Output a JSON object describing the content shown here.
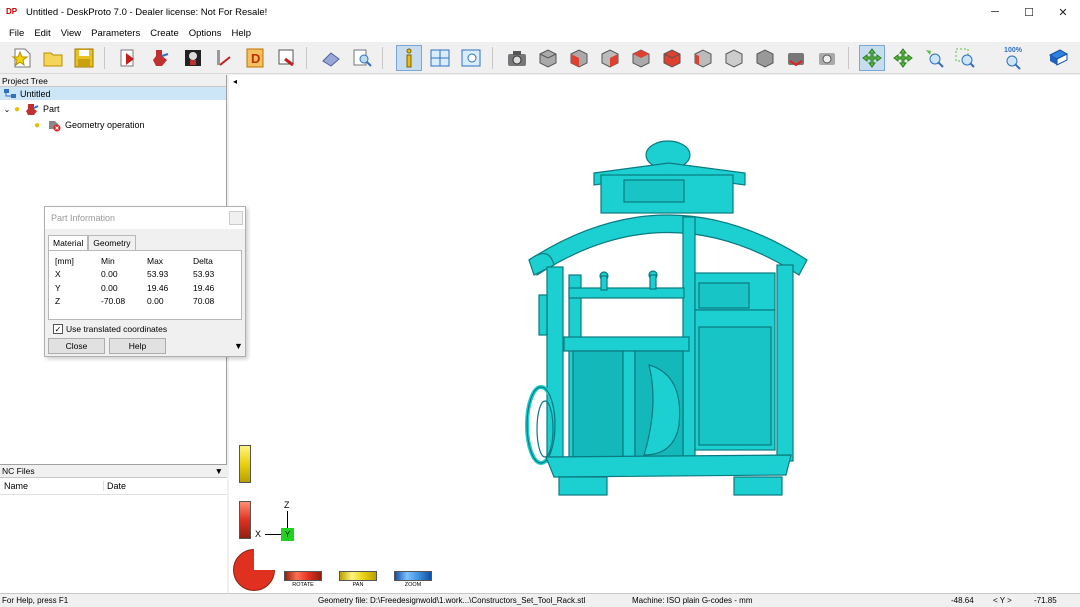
{
  "window": {
    "title": "Untitled - DeskProto 7.0 - Dealer license: Not For Resale!",
    "icon_text": "DP",
    "minimize": "─",
    "maximize": "☐",
    "close": "✕"
  },
  "menu": [
    "File",
    "Edit",
    "View",
    "Parameters",
    "Create",
    "Options",
    "Help"
  ],
  "project_tree": {
    "header": "Project Tree",
    "root": "Untitled",
    "part": "Part",
    "operation": "Geometry operation"
  },
  "nc_files": {
    "header": "NC Files",
    "col_name": "Name",
    "col_date": "Date"
  },
  "part_info": {
    "title": "Part Information",
    "tabs": [
      "Material",
      "Geometry"
    ],
    "columns": [
      "[mm]",
      "Min",
      "Max",
      "Delta"
    ],
    "rows": [
      [
        "X",
        "0.00",
        "53.93",
        "53.93"
      ],
      [
        "Y",
        "0.00",
        "19.46",
        "19.46"
      ],
      [
        "Z",
        "-70.08",
        "0.00",
        "70.08"
      ]
    ],
    "checkbox_label": "Use translated coordinates",
    "checkbox_checked": true,
    "close_label": "Close",
    "help_label": "Help"
  },
  "axes": {
    "z": "Z",
    "x": "X",
    "y": "Y"
  },
  "nav": {
    "rotate": "ROTATE",
    "pan": "PAN",
    "zoom": "ZOOM"
  },
  "toolbar_zoom_label": "100%",
  "status": {
    "help": "For Help, press F1",
    "geometry_file": "Geometry file: D:\\Freedesignwold\\1.work...\\Constructors_Set_Tool_Rack.stl",
    "machine": "Machine: ISO plain G-codes - mm",
    "coord_x": "-48.64",
    "coord_axis": "< Y >",
    "coord_y": "-71.85"
  },
  "colors": {
    "model": "#1ccfd0",
    "selection": "#cde6f7",
    "rotate": "#e03020",
    "pan": "#f2e21a",
    "zoom": "#3b8fe0"
  }
}
